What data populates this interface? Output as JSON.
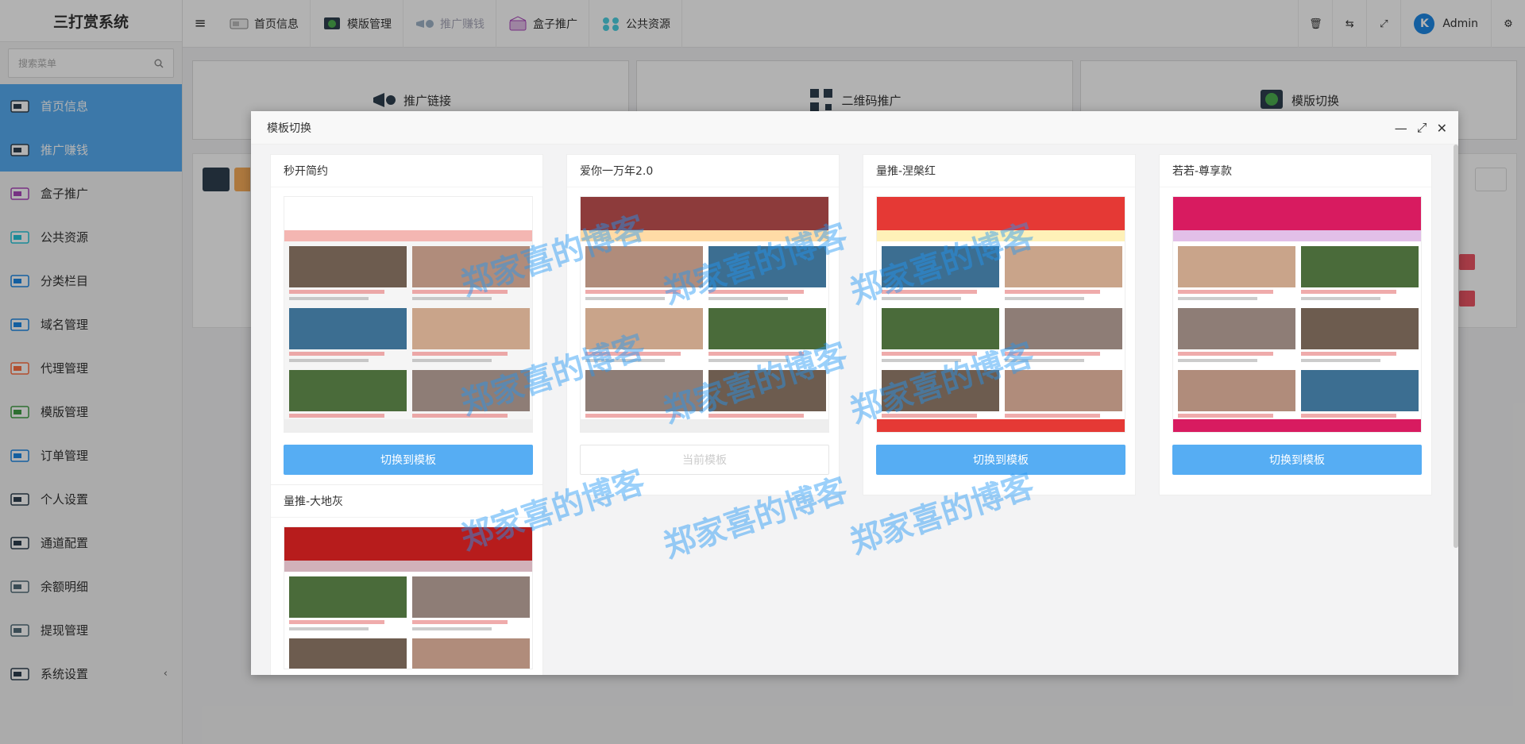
{
  "app": {
    "title": "三打赏系统"
  },
  "search": {
    "placeholder": "搜索菜单"
  },
  "sidebar": {
    "items": [
      {
        "label": "首页信息",
        "icon": "home-icon",
        "active": true
      },
      {
        "label": "推广赚钱",
        "icon": "promote-icon",
        "active": true
      },
      {
        "label": "盒子推广",
        "icon": "box-icon"
      },
      {
        "label": "公共资源",
        "icon": "resource-icon"
      },
      {
        "label": "分类栏目",
        "icon": "category-icon"
      },
      {
        "label": "域名管理",
        "icon": "domain-icon"
      },
      {
        "label": "代理管理",
        "icon": "agent-icon"
      },
      {
        "label": "模版管理",
        "icon": "template-icon"
      },
      {
        "label": "订单管理",
        "icon": "order-icon"
      },
      {
        "label": "个人设置",
        "icon": "settings-icon"
      },
      {
        "label": "通道配置",
        "icon": "channel-icon"
      },
      {
        "label": "余额明细",
        "icon": "balance-icon"
      },
      {
        "label": "提现管理",
        "icon": "withdraw-icon"
      },
      {
        "label": "系统设置",
        "icon": "system-icon"
      }
    ]
  },
  "topbar": {
    "tabs": [
      "首页信息",
      "模版管理",
      "推广赚钱",
      "盒子推广",
      "公共资源"
    ],
    "user": "Admin"
  },
  "cards": [
    "推广链接",
    "二维码推广",
    "模版切换"
  ],
  "modal": {
    "title": "模板切换",
    "templates": [
      {
        "name": "秒开简约",
        "button": "切换到模板",
        "current": false
      },
      {
        "name": "爱你一万年2.0",
        "button": "当前模板",
        "current": true
      },
      {
        "name": "量推-涅槃红",
        "button": "切换到模板",
        "current": false
      },
      {
        "name": "若若-尊享款",
        "button": "切换到模板",
        "current": false
      },
      {
        "name": "量推-大地灰",
        "button": "",
        "current": false
      }
    ]
  },
  "watermark": "郑家喜的博客",
  "colors": {
    "accent": "#56adf3",
    "danger": "#ed5565",
    "warning": "#f8ac59",
    "dark": "#2f4050"
  }
}
